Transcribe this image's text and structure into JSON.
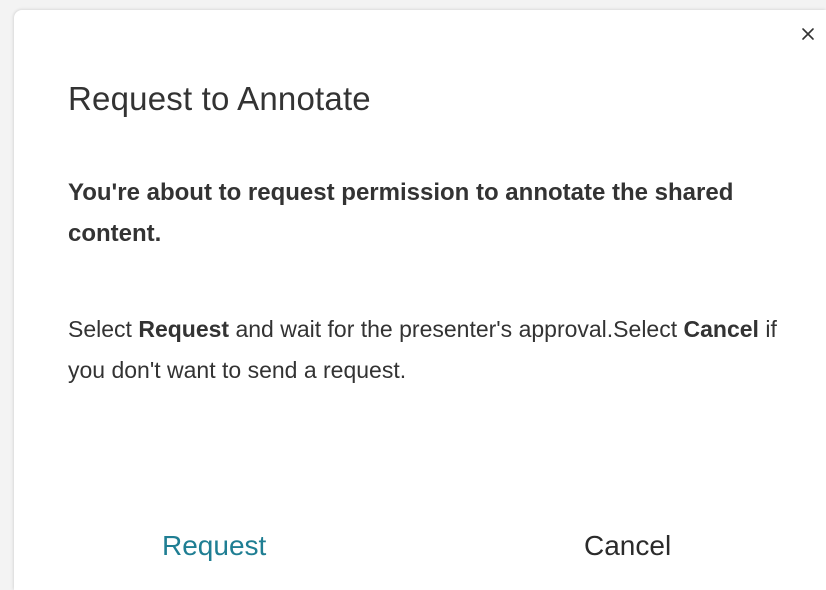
{
  "dialog": {
    "title": "Request to Annotate",
    "headline": "You're about to request permission to annotate the shared content.",
    "body": {
      "part1": "Select ",
      "request_word": "Request",
      "part2": " and wait for the presenter's approval.Select ",
      "cancel_word": "Cancel",
      "part3": " if you don't want to send a request."
    },
    "close_icon": "close-icon",
    "buttons": {
      "request_label": "Request",
      "cancel_label": "Cancel"
    }
  },
  "colors": {
    "accent": "#1f7e93",
    "text": "#333333",
    "background": "#ffffff"
  }
}
